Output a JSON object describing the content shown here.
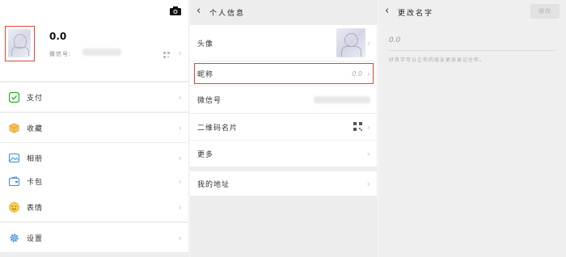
{
  "me": {
    "nickname": "0.0",
    "wechat_id_label": "微信号:",
    "menu": [
      {
        "label": "支付",
        "icon": "pay-icon",
        "color": "#1aad19"
      },
      {
        "label": "收藏",
        "icon": "favorites-icon",
        "color": "#f0a030"
      },
      {
        "label": "相册",
        "icon": "album-icon",
        "color": "#3b8fe0"
      },
      {
        "label": "卡包",
        "icon": "cards-icon",
        "color": "#3b8fe0"
      },
      {
        "label": "表情",
        "icon": "sticker-icon",
        "color": "#f0b020"
      },
      {
        "label": "设置",
        "icon": "settings-icon",
        "color": "#3b8fe0"
      }
    ]
  },
  "profile": {
    "title": "个人信息",
    "rows": {
      "avatar": "头像",
      "name": "昵称",
      "name_value": "0.0",
      "wechat_id": "微信号",
      "qr": "二维码名片",
      "more": "更多",
      "address": "我的地址"
    }
  },
  "edit_name": {
    "title": "更改名字",
    "save": "保存",
    "value": "0.0",
    "hint": "好名字可以让你的朋友更容易记住你。"
  },
  "colors": {
    "highlight": "#e0453a"
  }
}
